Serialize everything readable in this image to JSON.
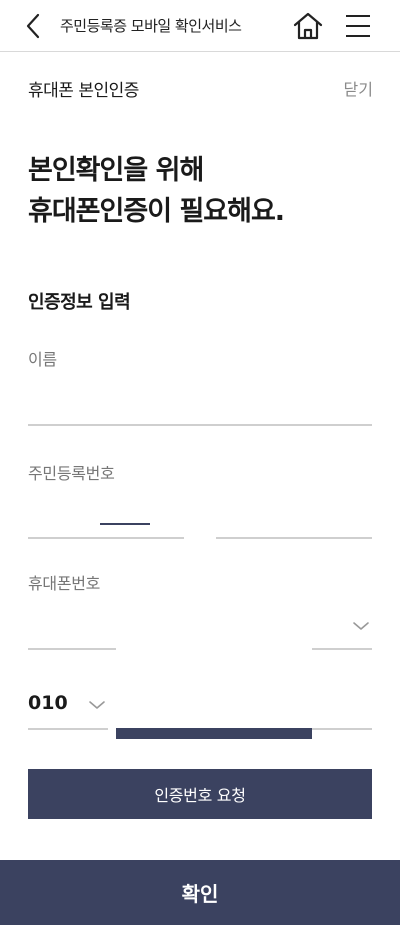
{
  "appbar": {
    "title": "주민등록증 모바일 확인서비스",
    "back_icon": "chevron-left-icon",
    "home_icon": "home-icon",
    "menu_icon": "hamburger-menu-icon"
  },
  "page": {
    "title": "휴대폰 본인인증",
    "close_label": "닫기"
  },
  "headline": {
    "line1": "본인확인을 위해",
    "line2": "휴대폰인증이 필요해요."
  },
  "form": {
    "section_label": "인증정보 입력",
    "name_label": "이름",
    "name_value": "",
    "rrn_label": "주민등록번호",
    "phone_label": "휴대폰번호",
    "carrier_value": "010"
  },
  "actions": {
    "request_label": "인증번호 요청",
    "confirm_label": "확인"
  },
  "colors": {
    "primary": "#3b4260",
    "divider": "#cfcfcf",
    "muted_text": "#777777"
  }
}
